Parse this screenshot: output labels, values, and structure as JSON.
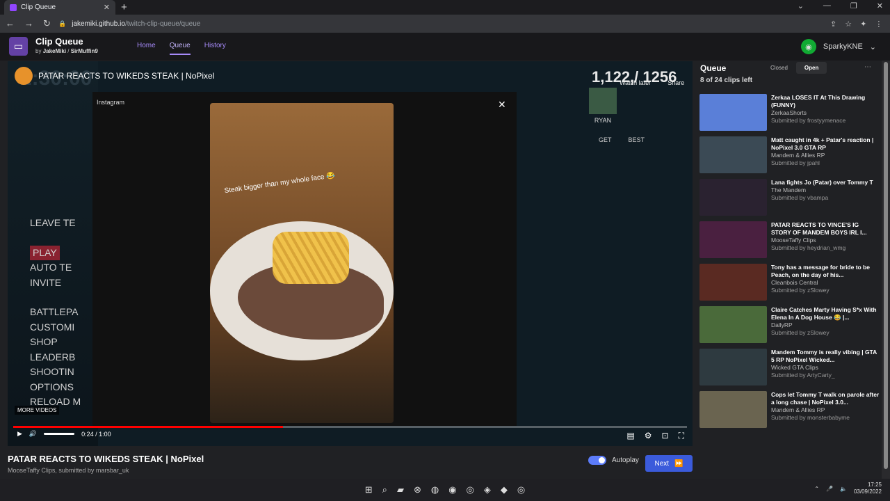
{
  "browser": {
    "tab_title": "Clip Queue",
    "url_host": "jakemiki.github.io",
    "url_path": "/twitch-clip-queue/queue"
  },
  "app": {
    "name": "Clip Queue",
    "by": "by",
    "author1": "JakeMiki",
    "author2": "SirMuffin9",
    "nav": [
      "Home",
      "Queue",
      "History"
    ],
    "username": "SparkyKNE"
  },
  "player": {
    "video_title": "PATAR REACTS TO WIKEDS STEAK | NoPixel",
    "big_time": "2:30:00",
    "counter": "1,122,/ 1256",
    "watch_later": "Watch later",
    "share": "Share",
    "menu": [
      "LEAVE TE",
      "PLAY",
      "AUTO TE",
      "INVITE",
      "BATTLEPA",
      "CUSTOMI",
      "SHOP",
      "LEADERB",
      "SHOOTIN",
      "OPTIONS",
      "RELOAD M"
    ],
    "instagram": "Instagram",
    "caption": "Steak bigger than my whole face 😂",
    "ryan": "RYAN",
    "get": "GET",
    "best": "BEST",
    "more_videos": "MORE VIDEOS",
    "time": "0:24 / 1:00",
    "progress": 0.4
  },
  "below": {
    "title": "PATAR REACTS TO WIKEDS STEAK | NoPixel",
    "sub": "MooseTaffy Clips, submitted by marsbar_uk",
    "autoplay": "Autoplay",
    "next": "Next"
  },
  "queue": {
    "heading": "Queue",
    "count": "8 of 24 clips left",
    "closed": "Closed",
    "open": "Open",
    "clips": [
      {
        "title": "Zerkaa LOSES IT At This Drawing (FUNNY)",
        "channel": "ZerkaaShorts",
        "submitted": "Submitted by frostyymenace",
        "color": "#5a7fd8"
      },
      {
        "title": "Matt caught in 4k + Patar's reaction | NoPixel 3.0 GTA RP",
        "channel": "Mandem & Allies RP",
        "submitted": "Submitted by jpahl",
        "color": "#3b4a55"
      },
      {
        "title": "Lana fights Jo (Patar) over Tommy T",
        "channel": "The Mandem",
        "submitted": "Submitted by vbampa",
        "color": "#2a2230"
      },
      {
        "title": "PATAR REACTS TO VINCE'S IG STORY OF MANDEM BOYS IRL I...",
        "channel": "MooseTaffy Clips",
        "submitted": "Submitted by heydrian_wmg",
        "color": "#4a2040"
      },
      {
        "title": "Tony has a message for bride to be Peach, on the day of his...",
        "channel": "Cleanbois Central",
        "submitted": "Submitted by zSlowey",
        "color": "#5a2a22"
      },
      {
        "title": "Claire Catches Marty Having S*x With Elena In A Dog House 😂 |...",
        "channel": "DallyRP",
        "submitted": "Submitted by zSlowey",
        "color": "#4a6a3a"
      },
      {
        "title": "Mandem Tommy is really vibing | GTA 5 RP NoPixel Wicked...",
        "channel": "Wicked GTA Clips",
        "submitted": "Submitted by ArtyCarty_",
        "color": "#2e3a40"
      },
      {
        "title": "Cops let Tommy T walk on parole after a long chase | NoPixel 3.0...",
        "channel": "Mandem & Allies RP",
        "submitted": "Submitted by monsterbabyme",
        "color": "#6a6450"
      }
    ]
  },
  "taskbar": {
    "time": "17:25",
    "date": "03/09/2022"
  }
}
